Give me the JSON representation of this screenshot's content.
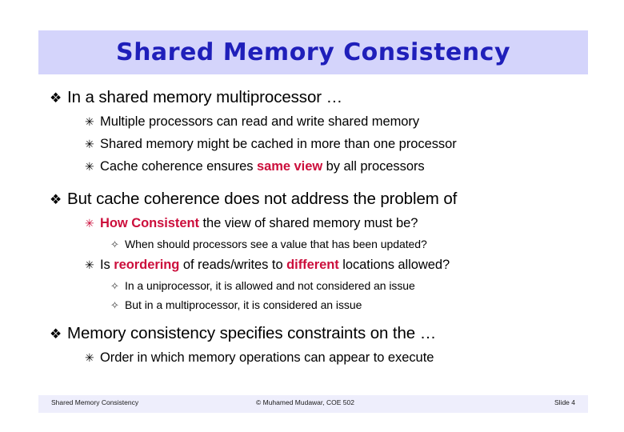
{
  "slide": {
    "title": "Shared Memory Consistency",
    "title_color": "#1f1fba",
    "title_band_color": "#d4d4fb",
    "accent_color": "#cc0f3c"
  },
  "bullets": {
    "b1": {
      "marker": "❖",
      "text": "In a shared memory multiprocessor …"
    },
    "b1a": {
      "marker": "✳",
      "text": "Multiple processors can read and write shared memory"
    },
    "b1b": {
      "marker": "✳",
      "text": "Shared memory might be cached in more than one processor"
    },
    "b1c_pre": {
      "marker": "✳",
      "text": "Cache coherence ensures "
    },
    "b1c_hl": {
      "text": "same view"
    },
    "b1c_post": {
      "text": " by all processors"
    },
    "b2": {
      "marker": "❖",
      "text": "But cache coherence does not address the problem of"
    },
    "b2a_hl": {
      "marker": "✳",
      "text": "How Consistent"
    },
    "b2a_post": {
      "text": " the view of shared memory must be?"
    },
    "b2a_i": {
      "marker": "✧",
      "text": "When should processors see a value that has been updated?"
    },
    "b2b_pre": {
      "marker": "✳",
      "text": "Is "
    },
    "b2b_hl1": {
      "text": "reordering"
    },
    "b2b_mid": {
      "text": " of reads/writes to "
    },
    "b2b_hl2": {
      "text": "different"
    },
    "b2b_post": {
      "text": " locations allowed?"
    },
    "b2b_i1": {
      "marker": "✧",
      "text": "In a uniprocessor, it is allowed and not considered an issue"
    },
    "b2b_i2": {
      "marker": "✧",
      "text": "But in a multiprocessor, it is considered an issue"
    },
    "b3": {
      "marker": "❖",
      "text": "Memory consistency specifies constraints on the …"
    },
    "b3a": {
      "marker": "✳",
      "text": "Order in which memory operations can appear to execute"
    }
  },
  "footer": {
    "left": "Shared Memory Consistency",
    "center": "© Muhamed Mudawar, COE 502",
    "right": "Slide 4"
  }
}
